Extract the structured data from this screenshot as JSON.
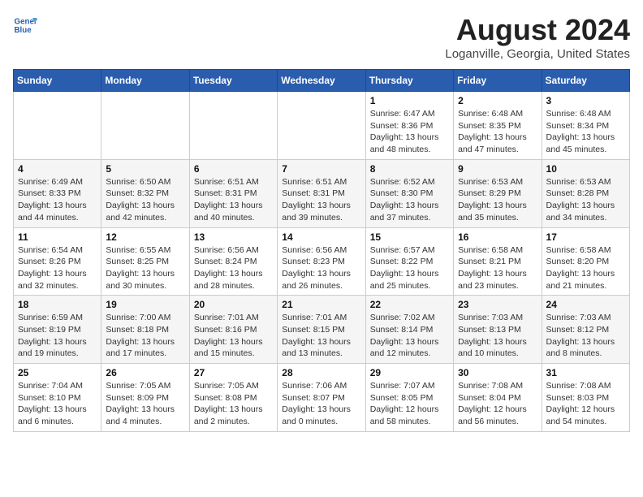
{
  "header": {
    "logo_line1": "General",
    "logo_line2": "Blue",
    "main_title": "August 2024",
    "subtitle": "Loganville, Georgia, United States"
  },
  "weekdays": [
    "Sunday",
    "Monday",
    "Tuesday",
    "Wednesday",
    "Thursday",
    "Friday",
    "Saturday"
  ],
  "weeks": [
    [
      {
        "day": "",
        "info": ""
      },
      {
        "day": "",
        "info": ""
      },
      {
        "day": "",
        "info": ""
      },
      {
        "day": "",
        "info": ""
      },
      {
        "day": "1",
        "info": "Sunrise: 6:47 AM\nSunset: 8:36 PM\nDaylight: 13 hours and 48 minutes."
      },
      {
        "day": "2",
        "info": "Sunrise: 6:48 AM\nSunset: 8:35 PM\nDaylight: 13 hours and 47 minutes."
      },
      {
        "day": "3",
        "info": "Sunrise: 6:48 AM\nSunset: 8:34 PM\nDaylight: 13 hours and 45 minutes."
      }
    ],
    [
      {
        "day": "4",
        "info": "Sunrise: 6:49 AM\nSunset: 8:33 PM\nDaylight: 13 hours and 44 minutes."
      },
      {
        "day": "5",
        "info": "Sunrise: 6:50 AM\nSunset: 8:32 PM\nDaylight: 13 hours and 42 minutes."
      },
      {
        "day": "6",
        "info": "Sunrise: 6:51 AM\nSunset: 8:31 PM\nDaylight: 13 hours and 40 minutes."
      },
      {
        "day": "7",
        "info": "Sunrise: 6:51 AM\nSunset: 8:31 PM\nDaylight: 13 hours and 39 minutes."
      },
      {
        "day": "8",
        "info": "Sunrise: 6:52 AM\nSunset: 8:30 PM\nDaylight: 13 hours and 37 minutes."
      },
      {
        "day": "9",
        "info": "Sunrise: 6:53 AM\nSunset: 8:29 PM\nDaylight: 13 hours and 35 minutes."
      },
      {
        "day": "10",
        "info": "Sunrise: 6:53 AM\nSunset: 8:28 PM\nDaylight: 13 hours and 34 minutes."
      }
    ],
    [
      {
        "day": "11",
        "info": "Sunrise: 6:54 AM\nSunset: 8:26 PM\nDaylight: 13 hours and 32 minutes."
      },
      {
        "day": "12",
        "info": "Sunrise: 6:55 AM\nSunset: 8:25 PM\nDaylight: 13 hours and 30 minutes."
      },
      {
        "day": "13",
        "info": "Sunrise: 6:56 AM\nSunset: 8:24 PM\nDaylight: 13 hours and 28 minutes."
      },
      {
        "day": "14",
        "info": "Sunrise: 6:56 AM\nSunset: 8:23 PM\nDaylight: 13 hours and 26 minutes."
      },
      {
        "day": "15",
        "info": "Sunrise: 6:57 AM\nSunset: 8:22 PM\nDaylight: 13 hours and 25 minutes."
      },
      {
        "day": "16",
        "info": "Sunrise: 6:58 AM\nSunset: 8:21 PM\nDaylight: 13 hours and 23 minutes."
      },
      {
        "day": "17",
        "info": "Sunrise: 6:58 AM\nSunset: 8:20 PM\nDaylight: 13 hours and 21 minutes."
      }
    ],
    [
      {
        "day": "18",
        "info": "Sunrise: 6:59 AM\nSunset: 8:19 PM\nDaylight: 13 hours and 19 minutes."
      },
      {
        "day": "19",
        "info": "Sunrise: 7:00 AM\nSunset: 8:18 PM\nDaylight: 13 hours and 17 minutes."
      },
      {
        "day": "20",
        "info": "Sunrise: 7:01 AM\nSunset: 8:16 PM\nDaylight: 13 hours and 15 minutes."
      },
      {
        "day": "21",
        "info": "Sunrise: 7:01 AM\nSunset: 8:15 PM\nDaylight: 13 hours and 13 minutes."
      },
      {
        "day": "22",
        "info": "Sunrise: 7:02 AM\nSunset: 8:14 PM\nDaylight: 13 hours and 12 minutes."
      },
      {
        "day": "23",
        "info": "Sunrise: 7:03 AM\nSunset: 8:13 PM\nDaylight: 13 hours and 10 minutes."
      },
      {
        "day": "24",
        "info": "Sunrise: 7:03 AM\nSunset: 8:12 PM\nDaylight: 13 hours and 8 minutes."
      }
    ],
    [
      {
        "day": "25",
        "info": "Sunrise: 7:04 AM\nSunset: 8:10 PM\nDaylight: 13 hours and 6 minutes."
      },
      {
        "day": "26",
        "info": "Sunrise: 7:05 AM\nSunset: 8:09 PM\nDaylight: 13 hours and 4 minutes."
      },
      {
        "day": "27",
        "info": "Sunrise: 7:05 AM\nSunset: 8:08 PM\nDaylight: 13 hours and 2 minutes."
      },
      {
        "day": "28",
        "info": "Sunrise: 7:06 AM\nSunset: 8:07 PM\nDaylight: 13 hours and 0 minutes."
      },
      {
        "day": "29",
        "info": "Sunrise: 7:07 AM\nSunset: 8:05 PM\nDaylight: 12 hours and 58 minutes."
      },
      {
        "day": "30",
        "info": "Sunrise: 7:08 AM\nSunset: 8:04 PM\nDaylight: 12 hours and 56 minutes."
      },
      {
        "day": "31",
        "info": "Sunrise: 7:08 AM\nSunset: 8:03 PM\nDaylight: 12 hours and 54 minutes."
      }
    ]
  ]
}
